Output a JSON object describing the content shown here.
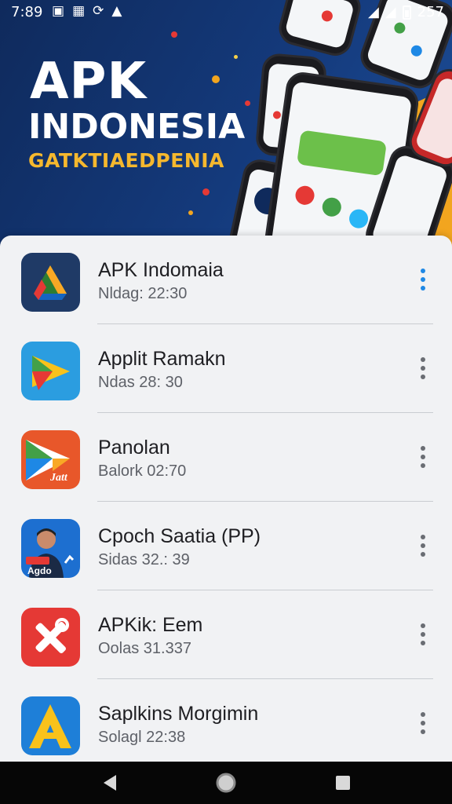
{
  "status_bar": {
    "time": "7:89",
    "right_text": "257",
    "icons": [
      "news-icon",
      "photo-icon",
      "sync-icon",
      "cap-icon",
      "wifi-icon",
      "signal-icon",
      "battery-icon"
    ]
  },
  "hero": {
    "title": "APK",
    "subtitle": "INDONESIA",
    "tagline": "GATKTIAEDPENIA",
    "colors": {
      "background": "#143a7c",
      "accent": "#f2a51f",
      "tagline": "#f5b82e"
    }
  },
  "apps": [
    {
      "name": "APK Indomaia",
      "meta": "Nldag: 22:30",
      "icon": "drive-triangle-icon"
    },
    {
      "name": "Applit Ramakn",
      "meta": "Ndas 28: 30",
      "icon": "play-triangle-icon"
    },
    {
      "name": "Panolan",
      "meta": "Balork 02:70",
      "icon": "play-store-icon",
      "icon_text": "Jatt"
    },
    {
      "name": "Cpoch Saatia (PP)",
      "meta": "Sidas 32.: 39",
      "icon": "person-badge-icon",
      "icon_text": "Agdo"
    },
    {
      "name": "APKik: Eem",
      "meta": "Oolas 31.337",
      "icon": "tools-cross-icon"
    },
    {
      "name": "Saplkins Morgimin",
      "meta": "Solagl 22:38",
      "icon": "letter-a-icon"
    }
  ],
  "navigation": {
    "back": "back-icon",
    "home": "home-icon",
    "recents": "recents-icon"
  }
}
